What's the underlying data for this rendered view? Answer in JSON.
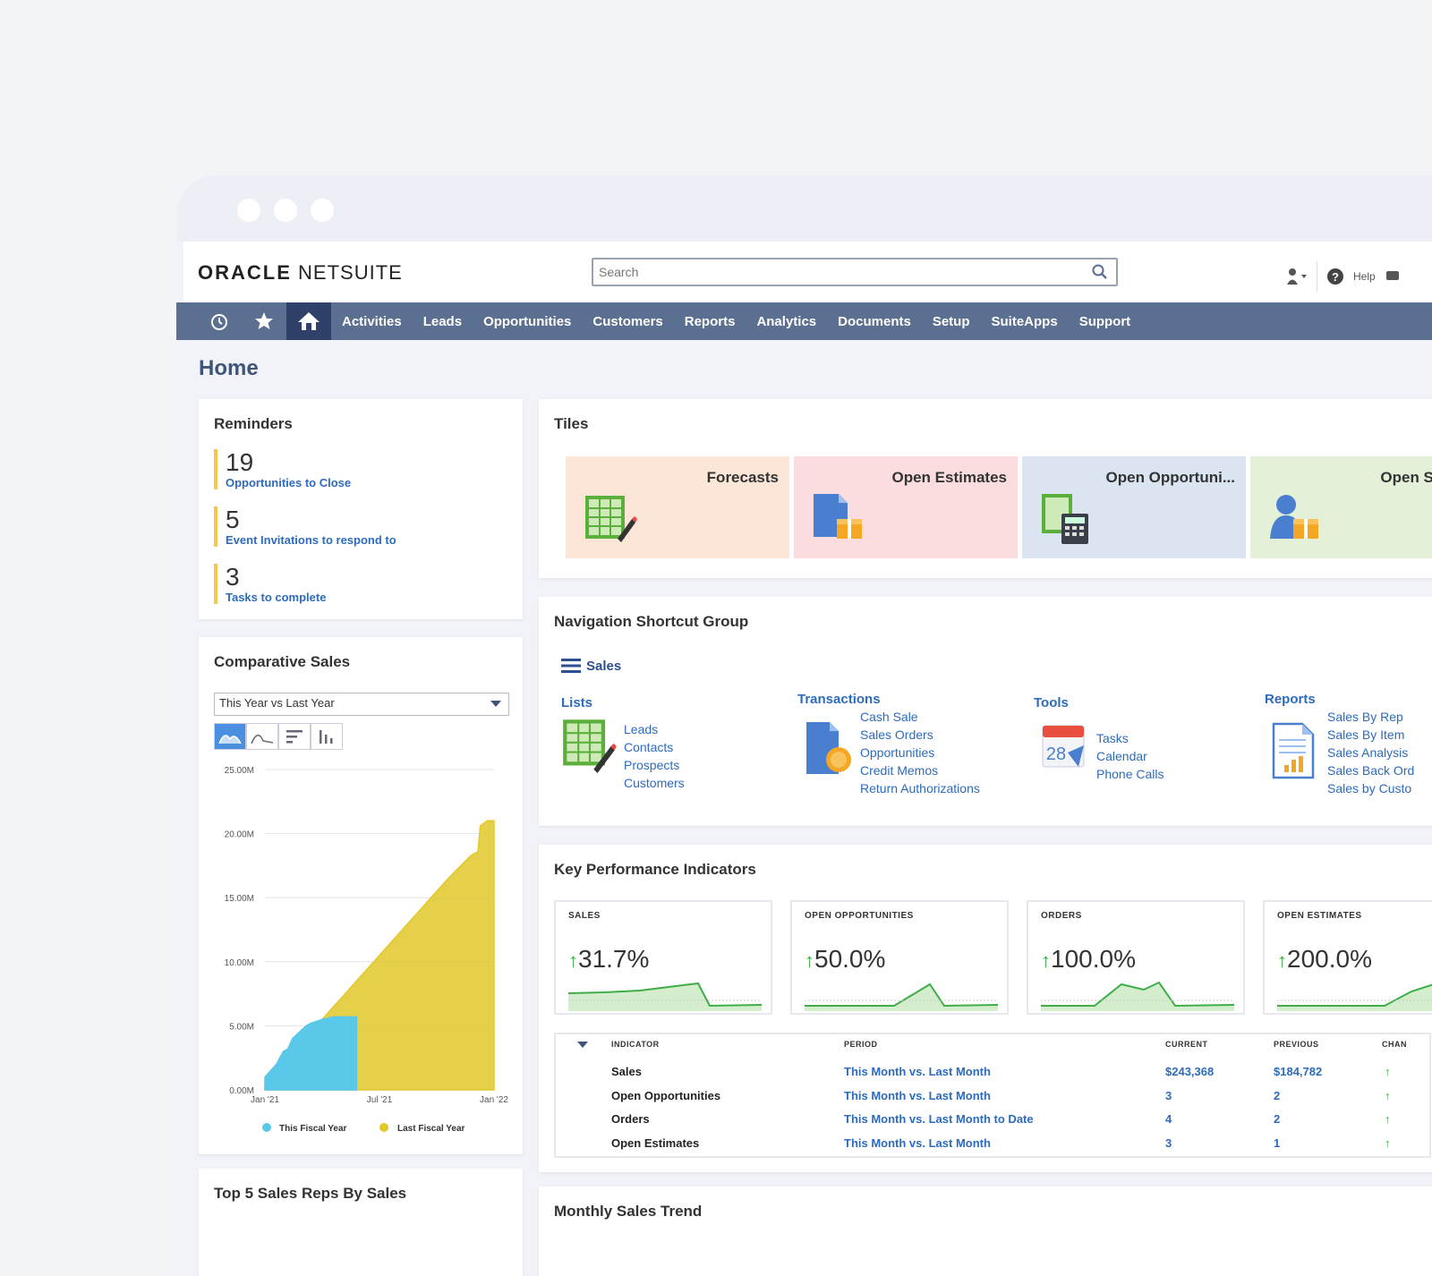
{
  "app": {
    "logo_oracle": "ORACLE",
    "logo_netsuite": "NETSUITE",
    "search_placeholder": "Search",
    "help_label": "Help"
  },
  "nav": {
    "items": [
      "Activities",
      "Leads",
      "Opportunities",
      "Customers",
      "Reports",
      "Analytics",
      "Documents",
      "Setup",
      "SuiteApps",
      "Support"
    ]
  },
  "page_title": "Home",
  "reminders": {
    "title": "Reminders",
    "items": [
      {
        "num": "19",
        "label": "Opportunities to Close"
      },
      {
        "num": "5",
        "label": "Event Invitations to respond to"
      },
      {
        "num": "3",
        "label": "Tasks to complete"
      }
    ]
  },
  "comparative_sales": {
    "title": "Comparative Sales",
    "select_value": "This Year vs Last Year",
    "legend_this": "This Fiscal Year",
    "legend_last": "Last Fiscal Year"
  },
  "chart_data": {
    "type": "area",
    "x_ticks": [
      "Jan '21",
      "Jul '21",
      "Jan '22"
    ],
    "y_ticks": [
      "0.00M",
      "5.00M",
      "10.00M",
      "15.00M",
      "20.00M",
      "25.00M"
    ],
    "ylim": [
      0,
      25
    ],
    "series": [
      {
        "name": "This Fiscal Year",
        "color": "#5ac8e8",
        "x": [
          0,
          0.05,
          0.08,
          0.1,
          0.12,
          0.15,
          0.18,
          0.2,
          0.25,
          0.3,
          0.4
        ],
        "values": [
          1.0,
          2.0,
          3.0,
          3.2,
          4.0,
          4.5,
          5.0,
          5.2,
          5.5,
          5.7,
          5.7
        ]
      },
      {
        "name": "Last Fiscal Year",
        "color": "#e2c82a",
        "x": [
          0,
          0.1,
          0.2,
          0.3,
          0.4,
          0.5,
          0.6,
          0.7,
          0.8,
          0.9,
          0.93,
          0.94,
          0.97,
          1.0
        ],
        "values": [
          0.5,
          2.5,
          4.5,
          6.5,
          8.5,
          10.5,
          12.5,
          14.5,
          16.5,
          18.3,
          18.6,
          20.6,
          21.0,
          21.0
        ]
      }
    ]
  },
  "top5": {
    "title": "Top 5 Sales Reps By Sales"
  },
  "tiles": {
    "title": "Tiles",
    "items": [
      {
        "label": "Forecasts",
        "bg": "#fbe6d8"
      },
      {
        "label": "Open Estimates",
        "bg": "#fbdde0"
      },
      {
        "label": "Open Opportuni...",
        "bg": "#dbe4f1"
      },
      {
        "label": "Open Sales",
        "bg": "#e4f0d8"
      }
    ]
  },
  "nsg": {
    "title": "Navigation Shortcut Group",
    "group": "Sales",
    "lists": {
      "heading": "Lists",
      "links": [
        "Leads",
        "Contacts",
        "Prospects",
        "Customers"
      ]
    },
    "transactions": {
      "heading": "Transactions",
      "links": [
        "Cash Sale",
        "Sales Orders",
        "Opportunities",
        "Credit Memos",
        "Return Authorizations"
      ]
    },
    "tools": {
      "heading": "Tools",
      "links": [
        "Tasks",
        "Calendar",
        "Phone Calls"
      ],
      "cal_num": "28"
    },
    "reports": {
      "heading": "Reports",
      "links": [
        "Sales By Rep",
        "Sales By Item",
        "Sales Analysis",
        "Sales Back Ord",
        "Sales by Custo"
      ]
    }
  },
  "kpi": {
    "title": "Key Performance Indicators",
    "boxes": [
      {
        "head": "SALES",
        "value": "31.7%"
      },
      {
        "head": "OPEN OPPORTUNITIES",
        "value": "50.0%"
      },
      {
        "head": "ORDERS",
        "value": "100.0%"
      },
      {
        "head": "OPEN ESTIMATES",
        "value": "200.0%"
      }
    ],
    "table": {
      "headers": {
        "indicator": "INDICATOR",
        "period": "PERIOD",
        "current": "CURRENT",
        "previous": "PREVIOUS",
        "change": "CHAN"
      },
      "rows": [
        {
          "indicator": "Sales",
          "period": "This Month vs. Last Month",
          "current": "$243,368",
          "previous": "$184,782"
        },
        {
          "indicator": "Open Opportunities",
          "period": "This Month vs. Last Month",
          "current": "3",
          "previous": "2"
        },
        {
          "indicator": "Orders",
          "period": "This Month vs. Last Month to Date",
          "current": "4",
          "previous": "2"
        },
        {
          "indicator": "Open Estimates",
          "period": "This Month vs. Last Month",
          "current": "3",
          "previous": "1"
        }
      ]
    }
  },
  "monthly": {
    "title": "Monthly Sales Trend"
  }
}
